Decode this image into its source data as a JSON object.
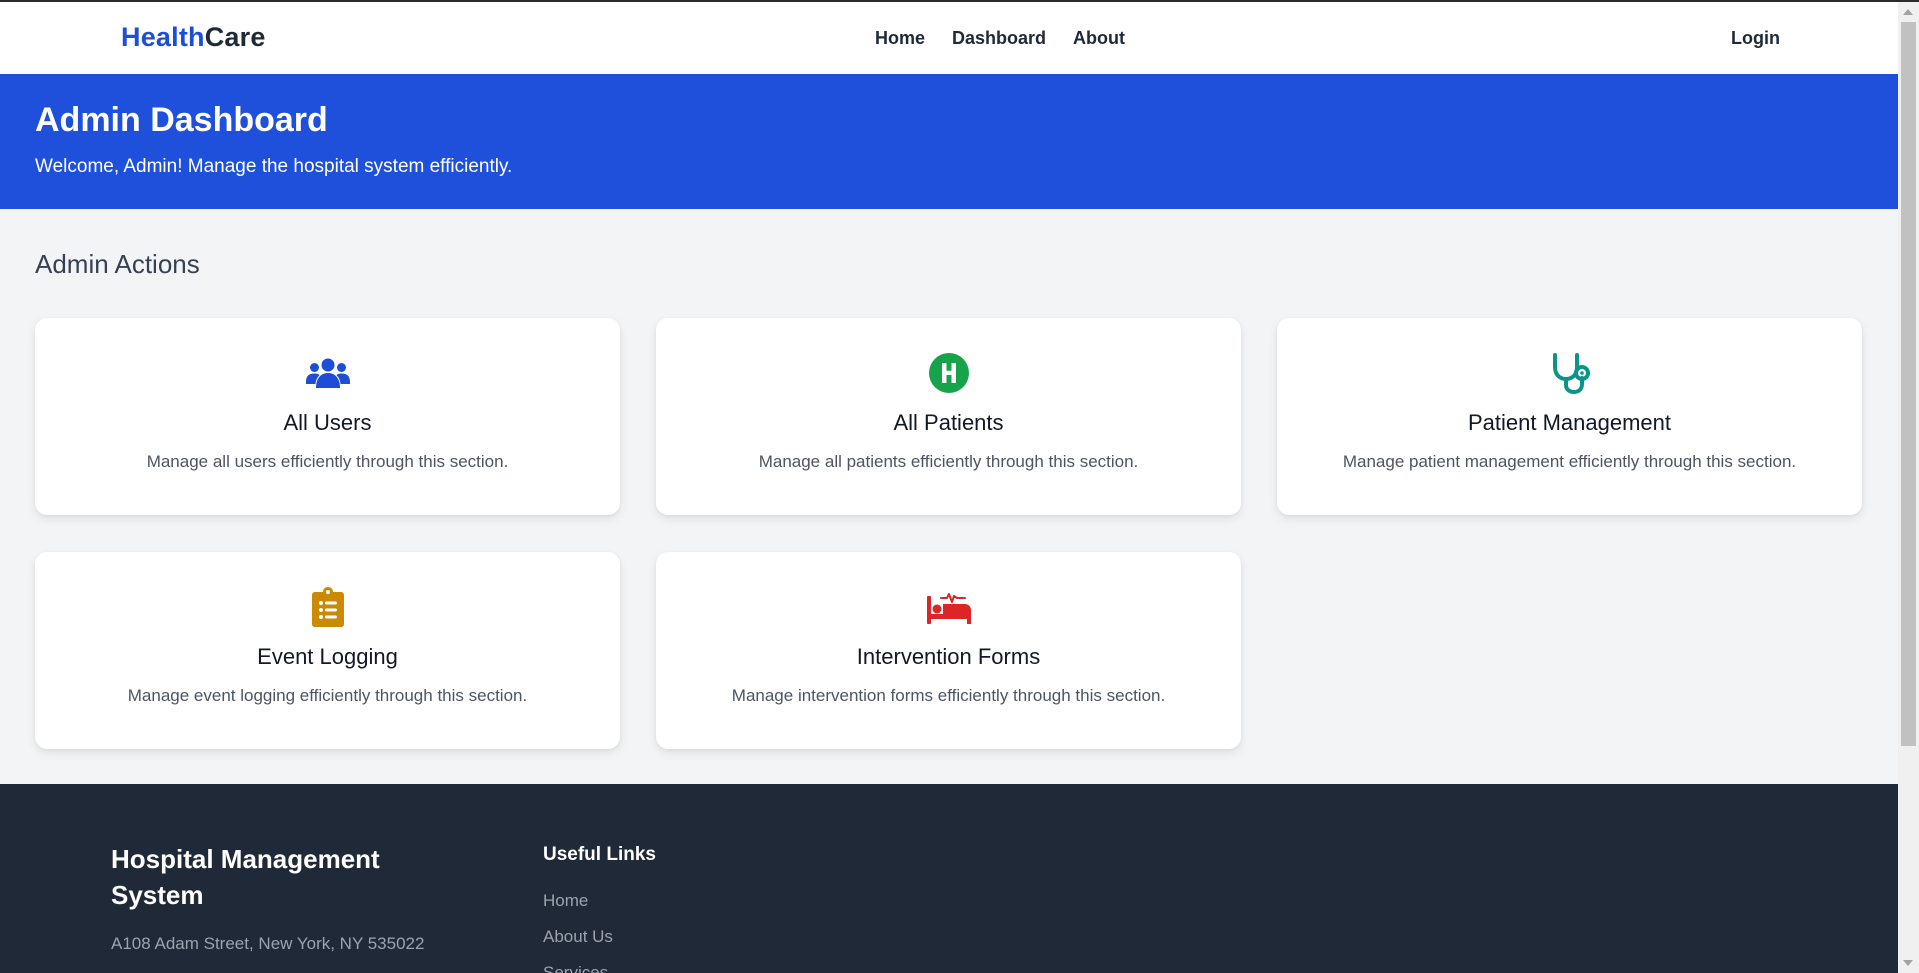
{
  "navbar": {
    "brand_part1": "Health",
    "brand_part2": "Care",
    "links": [
      "Home",
      "Dashboard",
      "About"
    ],
    "login": "Login"
  },
  "hero": {
    "title": "Admin Dashboard",
    "subtitle": "Welcome, Admin! Manage the hospital system efficiently."
  },
  "section": {
    "title": "Admin Actions"
  },
  "cards": [
    {
      "title": "All Users",
      "description": "Manage all users efficiently through this section.",
      "icon": "users-icon",
      "color": "#1d4ed8"
    },
    {
      "title": "All Patients",
      "description": "Manage all patients efficiently through this section.",
      "icon": "hospital-h-icon",
      "color": "#16a34a"
    },
    {
      "title": "Patient Management",
      "description": "Manage patient management efficiently through this section.",
      "icon": "stethoscope-icon",
      "color": "#0d9488"
    },
    {
      "title": "Event Logging",
      "description": "Manage event logging efficiently through this section.",
      "icon": "clipboard-list-icon",
      "color": "#ca8a04"
    },
    {
      "title": "Intervention Forms",
      "description": "Manage intervention forms efficiently through this section.",
      "icon": "bed-pulse-icon",
      "color": "#dc2626"
    }
  ],
  "footer": {
    "title": "Hospital Management System",
    "address": "A108 Adam Street, New York, NY 535022",
    "links_title": "Useful Links",
    "links": [
      "Home",
      "About Us",
      "Services"
    ]
  }
}
